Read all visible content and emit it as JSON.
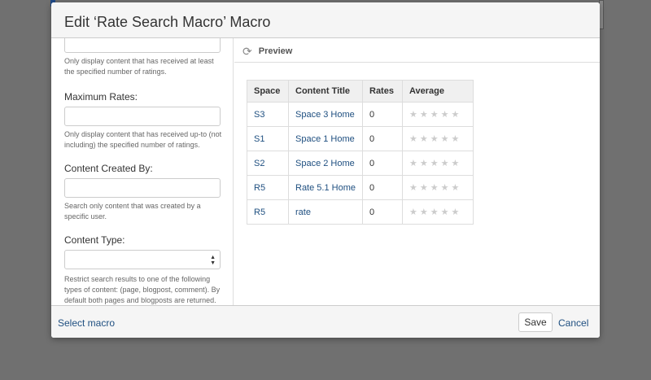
{
  "dialog": {
    "title": "Edit ‘Rate Search Macro’ Macro"
  },
  "form": {
    "min_rates_help": "Only display content that has received at least the specified number of ratings.",
    "max_rates_label": "Maximum Rates:",
    "max_rates_value": "",
    "max_rates_help": "Only display content that has received up-to (not including) the specified number of ratings.",
    "created_by_label": "Content Created By:",
    "created_by_value": "",
    "created_by_help": "Search only content that was created by a specific user.",
    "content_type_label": "Content Type:",
    "content_type_value": "",
    "content_type_help": "Restrict search results to one of the following types of content: (page, blogpost, comment). By default both pages and blogposts are returned."
  },
  "preview": {
    "label": "Preview",
    "icon": "refresh-icon",
    "columns": [
      "Space",
      "Content Title",
      "Rates",
      "Average"
    ],
    "rows": [
      {
        "space": "S3",
        "title": "Space 3 Home",
        "rates": "0",
        "average_stars": 0
      },
      {
        "space": "S1",
        "title": "Space 1 Home",
        "rates": "0",
        "average_stars": 0
      },
      {
        "space": "S2",
        "title": "Space 2 Home",
        "rates": "0",
        "average_stars": 0
      },
      {
        "space": "R5",
        "title": "Rate 5.1 Home",
        "rates": "0",
        "average_stars": 0
      },
      {
        "space": "R5",
        "title": "rate",
        "rates": "0",
        "average_stars": 0
      }
    ]
  },
  "footer": {
    "select_macro": "Select macro",
    "save": "Save",
    "cancel": "Cancel"
  },
  "colors": {
    "link": "#205081",
    "overlay": "#707070",
    "star_empty": "#cccccc"
  }
}
